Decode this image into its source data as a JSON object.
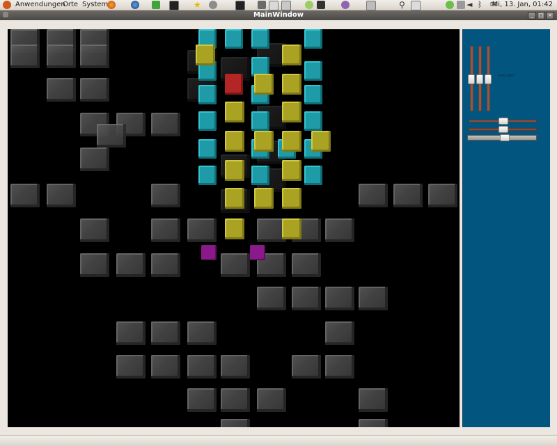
{
  "panel": {
    "menu_applications": "Anwendungen",
    "menu_places": "Orte",
    "menu_system": "System",
    "clock": "Mi, 13. Jan, 01:42"
  },
  "window": {
    "title": "MainWindow",
    "btn_minimize": "_",
    "btn_maximize": "□",
    "btn_close": "×"
  },
  "side_panel": {
    "label": "TextLabel",
    "vsliders": [
      0.5,
      0.5,
      0.5
    ],
    "hsliders": [
      0.5,
      0.5
    ]
  },
  "colors": {
    "viewport_bg": "#000000",
    "side_panel_bg": "#02557f",
    "cube_teal": "#1f9aa7",
    "cube_yellow": "#aaa222",
    "cube_red": "#b42626",
    "cube_magenta": "#8a1a8a"
  }
}
